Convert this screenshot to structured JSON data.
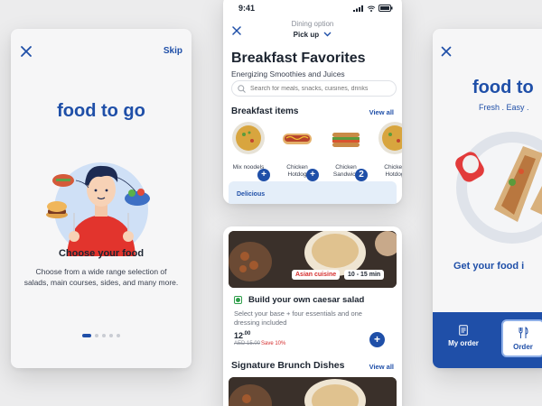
{
  "onboarding": {
    "skip_label": "Skip",
    "brand": "food to go",
    "heading": "Choose your food",
    "description": "Choose from a wide range selection of salads, main courses, sides, and many more.",
    "dots": 5,
    "active_dot": 0
  },
  "menu": {
    "status_time": "9:41",
    "dining_label": "Dining option",
    "dining_value": "Pick up",
    "title": "Breakfast Favorites",
    "subtitle": "Energizing Smoothies and Juices",
    "search_placeholder": "Search for meals, snacks, cuisines, drinks",
    "section_title": "Breakfast items",
    "view_all": "View all",
    "items": [
      {
        "name": "Mix noodels",
        "badge": "+"
      },
      {
        "name": "Chicken Hotdog",
        "badge": "+"
      },
      {
        "name": "Chicken Sandwich",
        "badge": "2"
      },
      {
        "name": "Chicken Hotdog",
        "badge": "+"
      }
    ],
    "promo_label": "Delicious"
  },
  "dish": {
    "tag_cuisine": "Asian cuisine",
    "tag_time": "10 - 15 min",
    "title": "Build your own caesar salad",
    "description": "Select your base + four essentials and one dressing included",
    "price_main": "12",
    "price_decimal": ".00",
    "old_price": "AED 15.00",
    "save": "Save 10%",
    "section_title": "Signature Brunch Dishes",
    "view_all": "View all"
  },
  "splash": {
    "brand": "food to",
    "tagline": "Fresh . Easy .",
    "cta": "Get your food i",
    "tabs": [
      {
        "label": "My order",
        "icon": "receipt-icon"
      },
      {
        "label": "Order",
        "icon": "cutlery-icon"
      }
    ]
  },
  "colors": {
    "brand_blue": "#1f4fa8",
    "accent_red": "#d52e2e",
    "veg_green": "#2f9e4a",
    "background": "#ececed"
  }
}
